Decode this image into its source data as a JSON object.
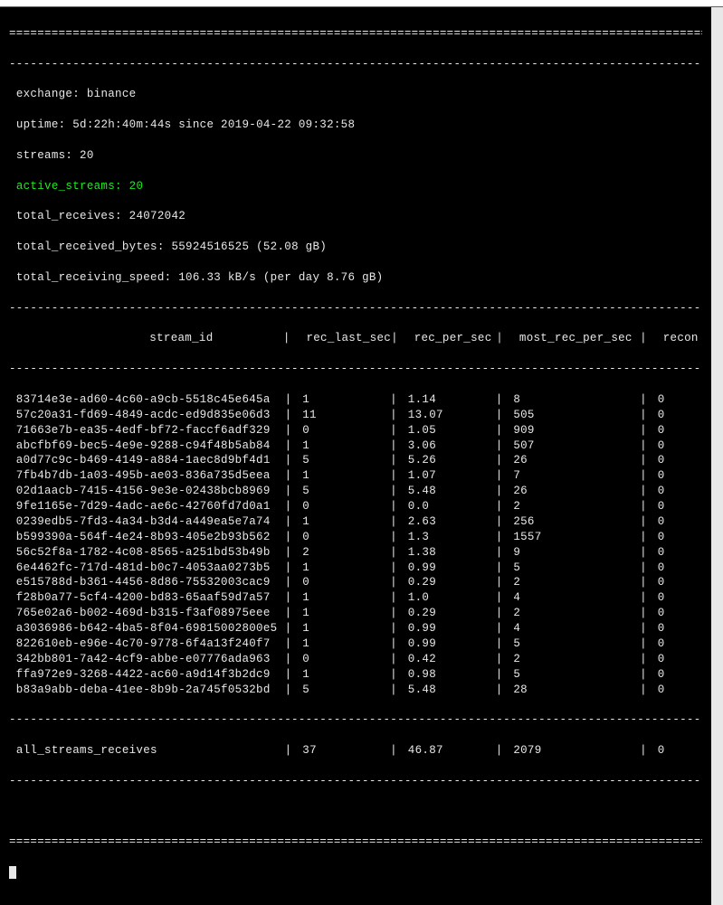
{
  "info": {
    "exchange_label": "exchange",
    "exchange_value": "binance",
    "uptime_label": "uptime",
    "uptime_value": "5d:22h:40m:44s since 2019-04-22 09:32:58",
    "streams_label": "streams",
    "streams_value": "20",
    "active_streams_label": "active_streams",
    "active_streams_value": "20",
    "total_receives_label": "total_receives",
    "total_receives_value": "24072042",
    "total_received_bytes_label": "total_received_bytes",
    "total_received_bytes_value": "55924516525 (52.08 gB)",
    "total_receiving_speed_label": "total_receiving_speed",
    "total_receiving_speed_value": "106.33 kB/s (per day 8.76 gB)"
  },
  "headers": {
    "stream_id": "stream_id",
    "rec_last_sec": "rec_last_sec",
    "rec_per_sec": "rec_per_sec",
    "most_rec_per_sec": "most_rec_per_sec",
    "recon": "recon"
  },
  "rows": [
    {
      "id": "83714e3e-ad60-4c60-a9cb-5518c45e645a",
      "a": "1",
      "b": "1.14",
      "c": "8",
      "d": "0"
    },
    {
      "id": "57c20a31-fd69-4849-acdc-ed9d835e06d3",
      "a": "11",
      "b": "13.07",
      "c": "505",
      "d": "0"
    },
    {
      "id": "71663e7b-ea35-4edf-bf72-faccf6adf329",
      "a": "0",
      "b": "1.05",
      "c": "909",
      "d": "0"
    },
    {
      "id": "abcfbf69-bec5-4e9e-9288-c94f48b5ab84",
      "a": "1",
      "b": "3.06",
      "c": "507",
      "d": "0"
    },
    {
      "id": "a0d77c9c-b469-4149-a884-1aec8d9bf4d1",
      "a": "5",
      "b": "5.26",
      "c": "26",
      "d": "0"
    },
    {
      "id": "7fb4b7db-1a03-495b-ae03-836a735d5eea",
      "a": "1",
      "b": "1.07",
      "c": "7",
      "d": "0"
    },
    {
      "id": "02d1aacb-7415-4156-9e3e-02438bcb8969",
      "a": "5",
      "b": "5.48",
      "c": "26",
      "d": "0"
    },
    {
      "id": "9fe1165e-7d29-4adc-ae6c-42760fd7d0a1",
      "a": "0",
      "b": "0.0",
      "c": "2",
      "d": "0"
    },
    {
      "id": "0239edb5-7fd3-4a34-b3d4-a449ea5e7a74",
      "a": "1",
      "b": "2.63",
      "c": "256",
      "d": "0"
    },
    {
      "id": "b599390a-564f-4e24-8b93-405e2b93b562",
      "a": "0",
      "b": "1.3",
      "c": "1557",
      "d": "0"
    },
    {
      "id": "56c52f8a-1782-4c08-8565-a251bd53b49b",
      "a": "2",
      "b": "1.38",
      "c": "9",
      "d": "0"
    },
    {
      "id": "6e4462fc-717d-481d-b0c7-4053aa0273b5",
      "a": "1",
      "b": "0.99",
      "c": "5",
      "d": "0"
    },
    {
      "id": "e515788d-b361-4456-8d86-75532003cac9",
      "a": "0",
      "b": "0.29",
      "c": "2",
      "d": "0"
    },
    {
      "id": "f28b0a77-5cf4-4200-bd83-65aaf59d7a57",
      "a": "1",
      "b": "1.0",
      "c": "4",
      "d": "0"
    },
    {
      "id": "765e02a6-b002-469d-b315-f3af08975eee",
      "a": "1",
      "b": "0.29",
      "c": "2",
      "d": "0"
    },
    {
      "id": "a3036986-b642-4ba5-8f04-69815002800e5",
      "a": "1",
      "b": "0.99",
      "c": "4",
      "d": "0"
    },
    {
      "id": "822610eb-e96e-4c70-9778-6f4a13f240f7",
      "a": "1",
      "b": "0.99",
      "c": "5",
      "d": "0"
    },
    {
      "id": "342bb801-7a42-4cf9-abbe-e07776ada963",
      "a": "0",
      "b": "0.42",
      "c": "2",
      "d": "0"
    },
    {
      "id": "ffa972e9-3268-4422-ac60-a9d14f3b2dc9",
      "a": "1",
      "b": "0.98",
      "c": "5",
      "d": "0"
    },
    {
      "id": "b83a9abb-deba-41ee-8b9b-2a745f0532bd",
      "a": "5",
      "b": "5.48",
      "c": "28",
      "d": "0"
    }
  ],
  "totals": {
    "label": "all_streams_receives",
    "a": "37",
    "b": "46.87",
    "c": "2079",
    "d": "0"
  },
  "separators": {
    "equals": "===================================================================================================",
    "dashes": "---------------------------------------------------------------------------------------------------"
  }
}
